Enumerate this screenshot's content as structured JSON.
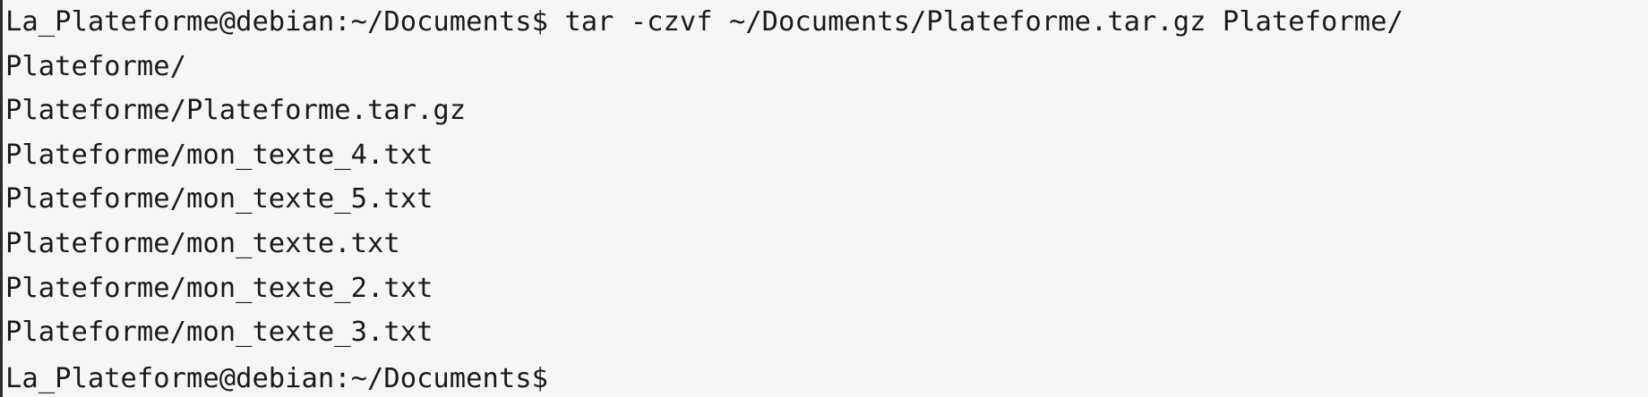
{
  "terminal": {
    "command_line": {
      "prompt": "La_Plateforme@debian:~/Documents$",
      "command": " tar -czvf ~/Documents/Plateforme.tar.gz Plateforme/"
    },
    "output": [
      "Plateforme/",
      "Plateforme/Plateforme.tar.gz",
      "Plateforme/mon_texte_4.txt",
      "Plateforme/mon_texte_5.txt",
      "Plateforme/mon_texte.txt",
      "Plateforme/mon_texte_2.txt",
      "Plateforme/mon_texte_3.txt"
    ],
    "final_prompt": "La_Plateforme@debian:~/Documents$"
  },
  "colors": {
    "background": "#f5f5f5",
    "text": "#1a1a1a",
    "left_border": "#2a2a2a"
  }
}
